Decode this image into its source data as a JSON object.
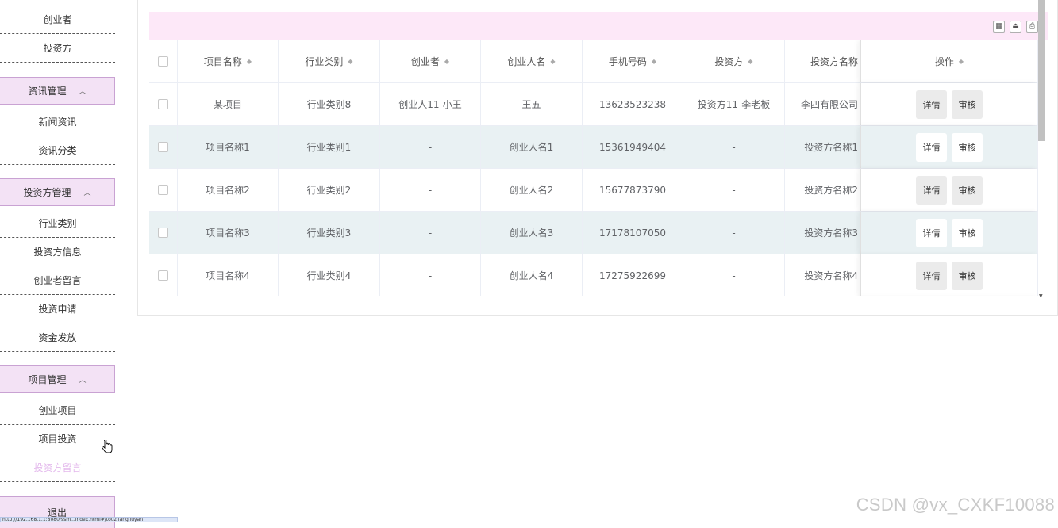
{
  "sidebar": {
    "top_items": [
      "创业者",
      "投资方"
    ],
    "groups": [
      {
        "label": "资讯管理",
        "items": [
          "新闻资讯",
          "资讯分类"
        ]
      },
      {
        "label": "投资方管理",
        "items": [
          "行业类别",
          "投资方信息",
          "创业者留言",
          "投资申请",
          "资金发放"
        ]
      },
      {
        "label": "项目管理",
        "items": [
          "创业项目",
          "项目投资",
          "投资方留言"
        ]
      }
    ],
    "logout_label": "退出",
    "chevron": "^"
  },
  "toolbar": {
    "icons": [
      "grid-icon",
      "export-icon",
      "print-icon"
    ]
  },
  "table": {
    "columns": [
      "项目名称",
      "行业类别",
      "创业者",
      "创业人名",
      "手机号码",
      "投资方",
      "投资方名称",
      "操作"
    ],
    "sort_glyph": "⇕",
    "rows": [
      [
        "某项目",
        "行业类别8",
        "创业人11-小王",
        "王五",
        "13623523238",
        "投资方11-李老板",
        "李四有限公司"
      ],
      [
        "项目名称1",
        "行业类别1",
        "-",
        "创业人名1",
        "15361949404",
        "-",
        "投资方名称1"
      ],
      [
        "项目名称2",
        "行业类别2",
        "-",
        "创业人名2",
        "15677873790",
        "-",
        "投资方名称2"
      ],
      [
        "项目名称3",
        "行业类别3",
        "-",
        "创业人名3",
        "17178107050",
        "-",
        "投资方名称3"
      ],
      [
        "项目名称4",
        "行业类别4",
        "-",
        "创业人名4",
        "17275922699",
        "-",
        "投资方名称4"
      ]
    ],
    "actions": {
      "detail": "详情",
      "review": "审核"
    }
  },
  "watermark": "CSDN @vx_CXKF10088",
  "statusbar_url": "http://192.168.1.1:8080/ssm...index.html#/touzifangliuyan"
}
